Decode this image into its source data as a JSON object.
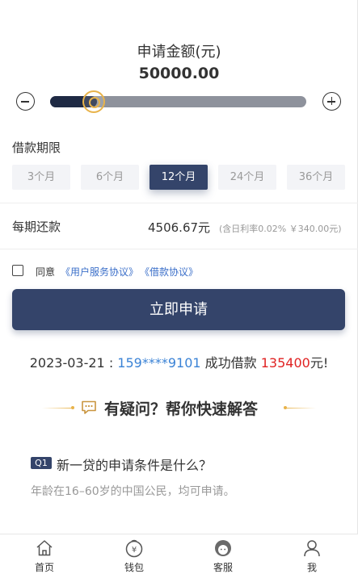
{
  "amount": {
    "title": "申请金额(元)",
    "value": "50000.00",
    "slider_fraction": 0.1
  },
  "loan_term": {
    "label": "借款期限",
    "options": [
      "3个月",
      "6个月",
      "12个月",
      "24个月",
      "36个月"
    ],
    "selected": "12个月"
  },
  "repayment": {
    "label": "每期还款",
    "value": "4506.67元",
    "note": "(含日利率0.02% ￥340.00元)"
  },
  "agreement": {
    "checked": false,
    "prefix": "同意",
    "link1": "《用户服务协议》",
    "link2": "《借款协议》"
  },
  "apply_button": "立即申请",
  "ticker": {
    "date": "2023-03-21 : ",
    "phone": "159****9101",
    "middle": " 成功借款 ",
    "amount": "135400",
    "suffix": "元!"
  },
  "faq": {
    "title": "有疑问？帮你快速解答",
    "items": [
      {
        "badge": "Q1",
        "question": "新一贷的申请条件是什么？",
        "answer": "年龄在16–60岁的中国公民，均可申请。"
      }
    ]
  },
  "tabbar": [
    {
      "label": "首页",
      "icon": "home-icon"
    },
    {
      "label": "钱包",
      "icon": "wallet-icon"
    },
    {
      "label": "客服",
      "icon": "customer-service-icon"
    },
    {
      "label": "我",
      "icon": "user-icon"
    }
  ],
  "colors": {
    "primary": "#34446a",
    "accent": "#e8b34a",
    "link": "#3b6fc9",
    "phone": "#3b83d6",
    "highlight": "#e02222"
  }
}
